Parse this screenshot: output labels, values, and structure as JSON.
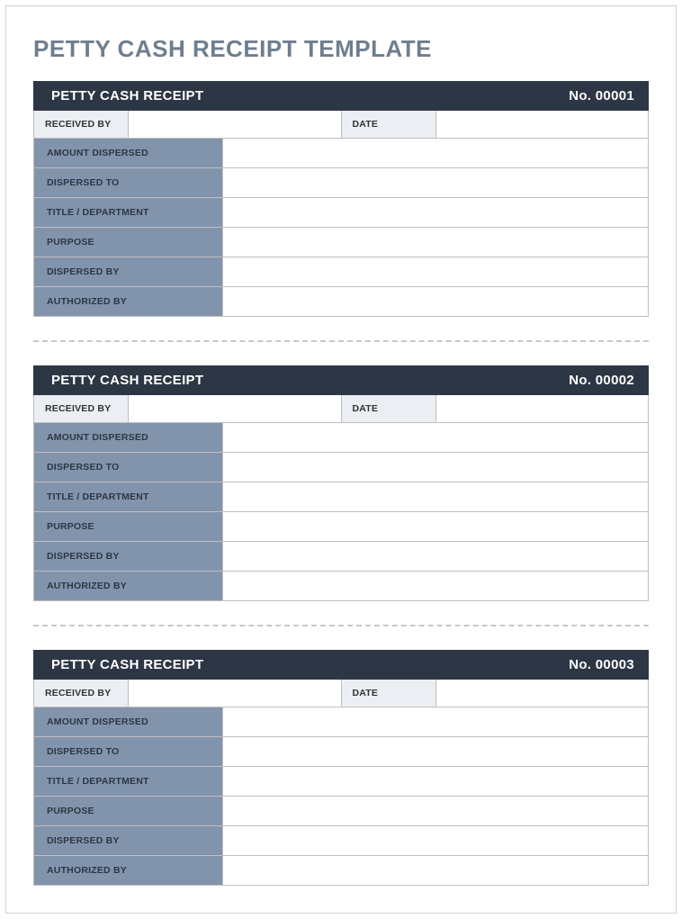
{
  "title": "PETTY CASH RECEIPT TEMPLATE",
  "labels": {
    "header": "PETTY CASH RECEIPT",
    "received_by": "RECEIVED BY",
    "date": "DATE",
    "amount_dispersed": "AMOUNT DISPERSED",
    "dispersed_to": "DISPERSED TO",
    "title_department": "TITLE / DEPARTMENT",
    "purpose": "PURPOSE",
    "dispersed_by": "DISPERSED BY",
    "authorized_by": "AUTHORIZED BY"
  },
  "receipts": [
    {
      "number": "No. 00001",
      "received_by": "",
      "date": "",
      "amount_dispersed": "",
      "dispersed_to": "",
      "title_department": "",
      "purpose": "",
      "dispersed_by": "",
      "authorized_by": ""
    },
    {
      "number": "No. 00002",
      "received_by": "",
      "date": "",
      "amount_dispersed": "",
      "dispersed_to": "",
      "title_department": "",
      "purpose": "",
      "dispersed_by": "",
      "authorized_by": ""
    },
    {
      "number": "No. 00003",
      "received_by": "",
      "date": "",
      "amount_dispersed": "",
      "dispersed_to": "",
      "title_department": "",
      "purpose": "",
      "dispersed_by": "",
      "authorized_by": ""
    }
  ]
}
